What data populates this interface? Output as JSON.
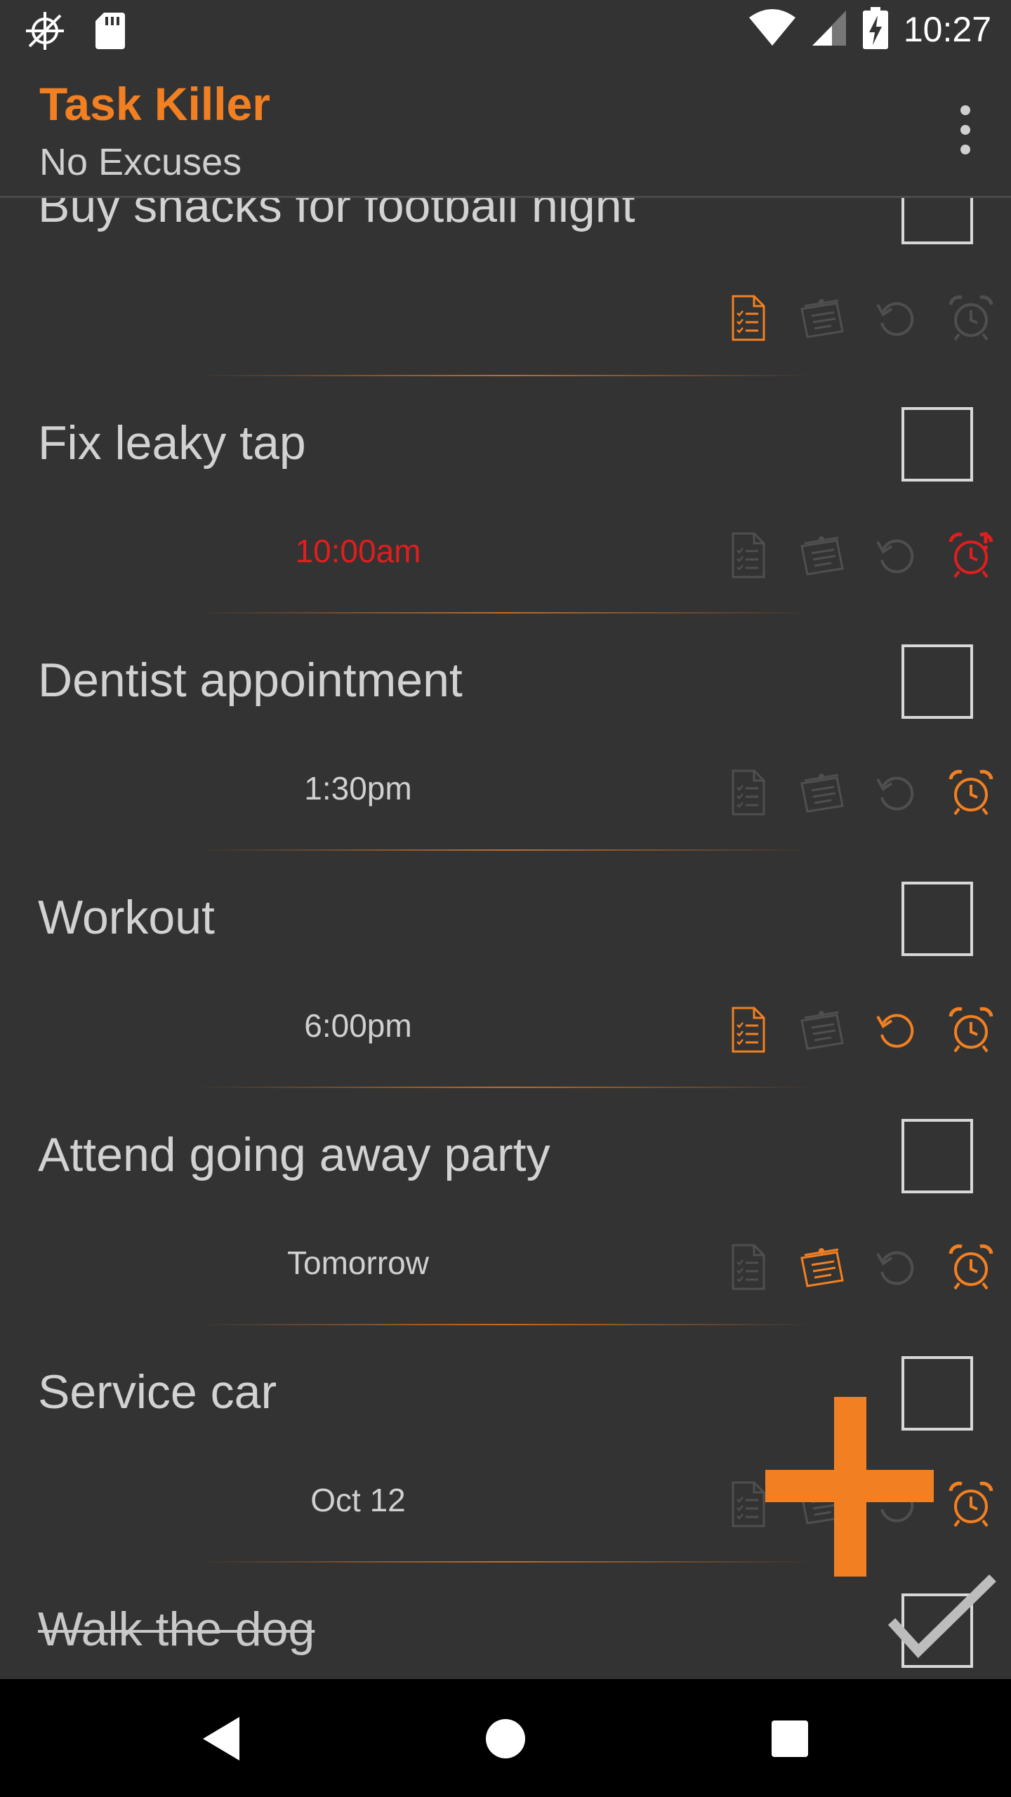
{
  "status_bar": {
    "time": "10:27",
    "left_icons": [
      "crosshair-icon",
      "sd-card-icon"
    ],
    "right_icons": [
      "wifi-icon",
      "cell-signal-icon",
      "battery-charging-icon"
    ]
  },
  "toolbar": {
    "title": "Task Killer",
    "subtitle": "No Excuses",
    "menu_icon": "overflow-menu-icon"
  },
  "colors": {
    "accent": "#f28022",
    "overdue": "#e01e1e",
    "background": "#333333",
    "inactive_icon": "#4f4f4f"
  },
  "tasks": [
    {
      "title": "Buy snacks for football night",
      "time": "",
      "checked": false,
      "overdue": false,
      "icons": {
        "checklist": true,
        "notes": false,
        "repeat": false,
        "alarm": false
      }
    },
    {
      "title": "Fix leaky tap",
      "time": "10:00am",
      "checked": false,
      "overdue": true,
      "icons": {
        "checklist": false,
        "notes": false,
        "repeat": false,
        "alarm": true
      }
    },
    {
      "title": "Dentist appointment",
      "time": "1:30pm",
      "checked": false,
      "overdue": false,
      "icons": {
        "checklist": false,
        "notes": false,
        "repeat": false,
        "alarm": true
      }
    },
    {
      "title": "Workout",
      "time": "6:00pm",
      "checked": false,
      "overdue": false,
      "icons": {
        "checklist": true,
        "notes": false,
        "repeat": true,
        "alarm": true
      }
    },
    {
      "title": "Attend going away party",
      "time": "Tomorrow",
      "checked": false,
      "overdue": false,
      "icons": {
        "checklist": false,
        "notes": true,
        "repeat": false,
        "alarm": true
      }
    },
    {
      "title": "Service car",
      "time": "Oct 12",
      "checked": false,
      "overdue": false,
      "icons": {
        "checklist": false,
        "notes": false,
        "repeat": false,
        "alarm": true
      }
    },
    {
      "title": "Walk the dog",
      "time": "",
      "checked": true,
      "overdue": false,
      "icons": {
        "checklist": false,
        "notes": false,
        "repeat": false,
        "alarm": false
      }
    }
  ],
  "fab": {
    "icon": "add-icon"
  },
  "nav_bar": {
    "icons": [
      "back-icon",
      "home-icon",
      "recents-icon"
    ]
  }
}
